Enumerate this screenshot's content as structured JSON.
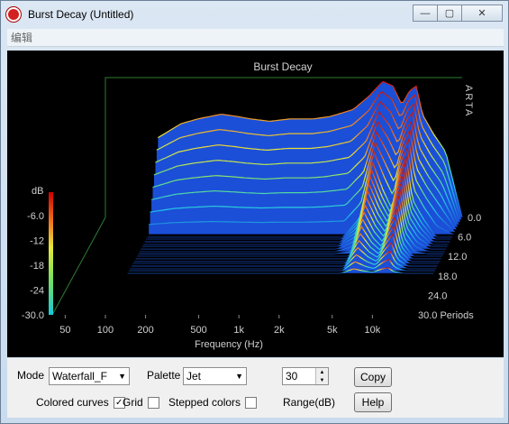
{
  "window": {
    "title": "Burst Decay  (Untitled)",
    "menu": [
      "编辑"
    ]
  },
  "chart_data": {
    "type": "area",
    "title": "Burst Decay",
    "xlabel": "Frequency (Hz)",
    "ylabel": "dB",
    "zlabel": "Periods",
    "watermark": "ARTA",
    "x_ticks": [
      "50",
      "100",
      "200",
      "500",
      "1k",
      "2k",
      "5k",
      "10k"
    ],
    "y_ticks": [
      "-6.0",
      "-12",
      "-18",
      "-24",
      "-30.0"
    ],
    "z_ticks": [
      "0.0",
      "6.0",
      "12.0",
      "18.0",
      "24.0",
      "30.0 Periods"
    ],
    "ylim": [
      -30,
      0
    ],
    "zlim": [
      0,
      30
    ],
    "xlim_hz": [
      40,
      20000
    ],
    "frequencies_hz": [
      100,
      150,
      200,
      300,
      400,
      500,
      700,
      1000,
      1500,
      2000,
      3000,
      4000,
      5000,
      6000,
      7000,
      8000,
      9000,
      10000,
      12000,
      15000,
      20000
    ],
    "series": [
      {
        "name": "0.0",
        "values": [
          -13,
          -10,
          -9,
          -8,
          -8.5,
          -9,
          -9.5,
          -9,
          -9,
          -8.5,
          -7,
          -4,
          -1,
          -2,
          -6,
          -3,
          -2,
          -8,
          -12,
          -16,
          -30
        ]
      },
      {
        "name": "6.0",
        "values": [
          -30,
          -30,
          -30,
          -30,
          -30,
          -30,
          -30,
          -30,
          -30,
          -30,
          -30,
          -26,
          -14,
          -20,
          -24,
          -16,
          -13,
          -22,
          -26,
          -30,
          -30
        ]
      },
      {
        "name": "12.0",
        "values": [
          -30,
          -30,
          -30,
          -30,
          -30,
          -30,
          -30,
          -30,
          -30,
          -30,
          -30,
          -30,
          -22,
          -26,
          -28,
          -23,
          -20,
          -27,
          -30,
          -30,
          -30
        ]
      },
      {
        "name": "18.0",
        "values": [
          -30,
          -30,
          -30,
          -30,
          -30,
          -30,
          -30,
          -30,
          -30,
          -30,
          -30,
          -30,
          -30,
          -30,
          -30,
          -30,
          -30,
          -30,
          -30,
          -30,
          -30
        ]
      },
      {
        "name": "24.0",
        "values": [
          -30,
          -30,
          -30,
          -30,
          -30,
          -30,
          -30,
          -30,
          -30,
          -30,
          -30,
          -30,
          -30,
          -30,
          -30,
          -30,
          -30,
          -30,
          -30,
          -30,
          -30
        ]
      },
      {
        "name": "30.0",
        "values": [
          -30,
          -30,
          -30,
          -30,
          -30,
          -30,
          -30,
          -30,
          -30,
          -30,
          -30,
          -30,
          -30,
          -30,
          -30,
          -30,
          -30,
          -30,
          -30,
          -30,
          -30
        ]
      }
    ],
    "palette": "jet",
    "grid": false
  },
  "controls": {
    "mode_label": "Mode",
    "mode_value": "Waterfall_F",
    "palette_label": "Palette",
    "palette_value": "Jet",
    "range_value": "30",
    "range_label": "Range(dB)",
    "copy_label": "Copy",
    "help_label": "Help",
    "colored_curves_label": "Colored curves",
    "colored_curves_checked": true,
    "grid_label": "Grid",
    "grid_checked": false,
    "stepped_colors_label": "Stepped colors",
    "stepped_colors_checked": false,
    "check_mark": "✓"
  }
}
